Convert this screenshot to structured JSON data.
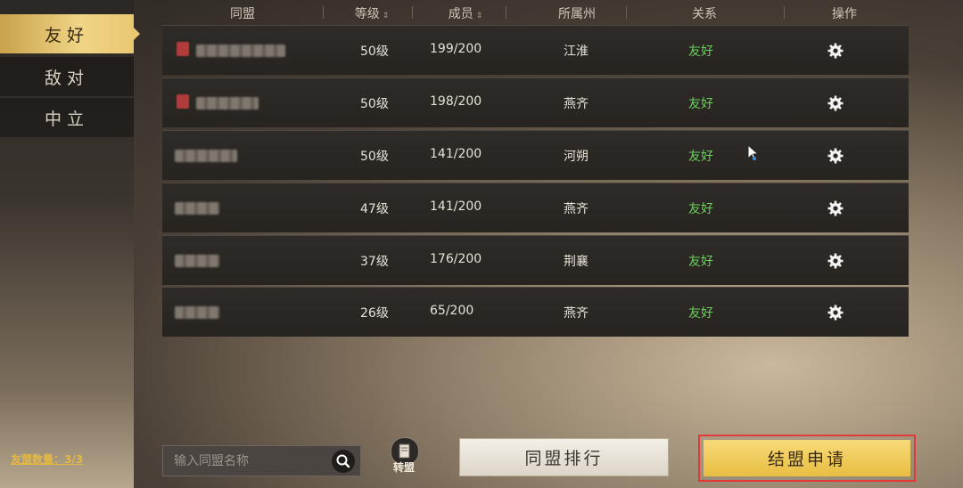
{
  "sidebar": {
    "tabs": [
      {
        "label": "友好",
        "active": true
      },
      {
        "label": "敌对",
        "active": false
      },
      {
        "label": "中立",
        "active": false
      }
    ],
    "friend_count": "友盟数量：3/3"
  },
  "table": {
    "headers": {
      "alliance": "同盟",
      "level": "等级",
      "members": "成员",
      "state": "所属州",
      "relation": "关系",
      "action": "操作"
    },
    "rows": [
      {
        "level": "50级",
        "members": "199/200",
        "state": "江淮",
        "relation": "友好"
      },
      {
        "level": "50级",
        "members": "198/200",
        "state": "燕齐",
        "relation": "友好"
      },
      {
        "level": "50级",
        "members": "141/200",
        "state": "河朔",
        "relation": "友好"
      },
      {
        "level": "47级",
        "members": "141/200",
        "state": "燕齐",
        "relation": "友好"
      },
      {
        "level": "37级",
        "members": "176/200",
        "state": "荆襄",
        "relation": "友好"
      },
      {
        "level": "26级",
        "members": "65/200",
        "state": "燕齐",
        "relation": "友好"
      }
    ]
  },
  "bottom": {
    "search_placeholder": "输入同盟名称",
    "transfer_label": "转盟",
    "rank_button": "同盟排行",
    "apply_button": "结盟申请"
  },
  "colors": {
    "active_tab": "#e9c871",
    "relation_friendly": "#6ad05e",
    "highlight_border": "#e03a3a"
  }
}
